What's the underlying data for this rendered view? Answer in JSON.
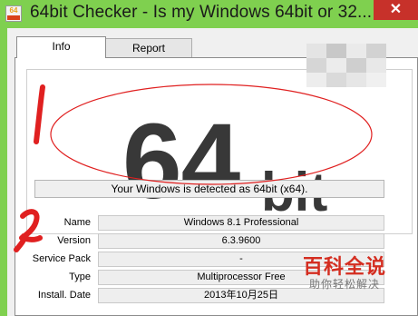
{
  "window": {
    "icon_text": "64",
    "title": "64bit Checker - Is my Windows 64bit or 32...",
    "close_glyph": "✕",
    "accent_color": "#7fd04f"
  },
  "tabs": [
    {
      "label": "Info",
      "selected": true
    },
    {
      "label": "Report",
      "selected": false
    }
  ],
  "result": {
    "number": "64",
    "unit": "bit",
    "detected_text": "Your Windows is detected as 64bit (x64)."
  },
  "info_rows": [
    {
      "label": "Name",
      "value": "Windows 8.1 Professional"
    },
    {
      "label": "Version",
      "value": "6.3.9600"
    },
    {
      "label": "Service Pack",
      "value": "-"
    },
    {
      "label": "Type",
      "value": "Multiprocessor Free"
    },
    {
      "label": "Install. Date",
      "value": "2013年10月25日"
    }
  ],
  "annotations": {
    "mark_1": "1",
    "mark_2": "2",
    "ink_color": "#e02020"
  },
  "watermark": {
    "main": "百科全说",
    "sub": "助你轻松解决"
  }
}
